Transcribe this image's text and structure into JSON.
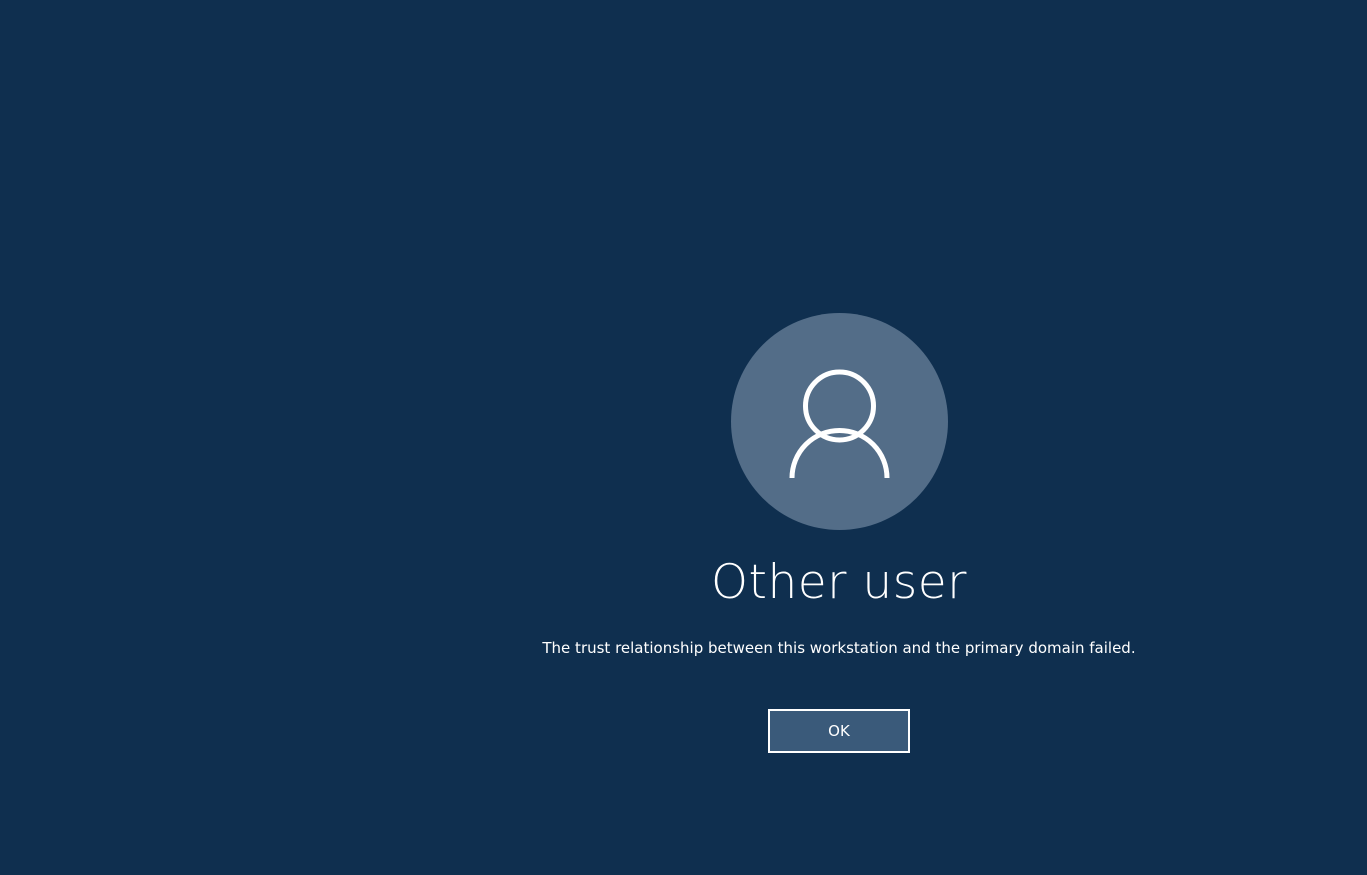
{
  "colors": {
    "background": "#0f2f4f",
    "avatar_circle": "#536d88",
    "button_fill": "#3a5a7a",
    "text": "#ffffff"
  },
  "user": {
    "avatar_icon": "person-outline-icon",
    "name": "Other user"
  },
  "message": {
    "text": "The trust relationship between this workstation and the primary domain failed."
  },
  "actions": {
    "ok_label": "OK"
  }
}
